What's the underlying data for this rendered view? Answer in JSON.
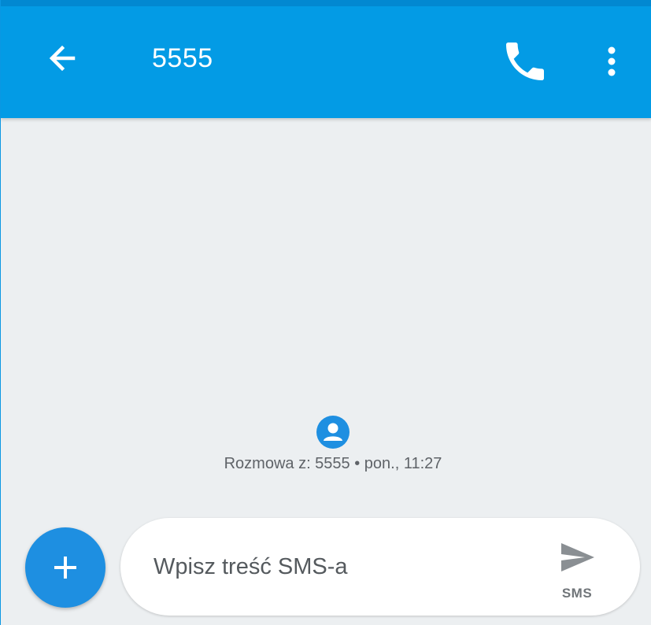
{
  "header": {
    "title": "5555",
    "back_icon": "arrow-left-icon",
    "call_icon": "phone-icon",
    "menu_icon": "more-vertical-icon"
  },
  "conversation": {
    "avatar_icon": "person-icon",
    "info_text": "Rozmowa z: 5555 • pon., 11:27"
  },
  "composer": {
    "attach_icon": "plus-icon",
    "placeholder": "Wpisz treść SMS-a",
    "send_icon": "send-icon",
    "send_label": "SMS"
  },
  "colors": {
    "app_bar": "#039be5",
    "status_bar": "#0288d1",
    "background": "#eceff1",
    "accent": "#1e8fe1"
  }
}
